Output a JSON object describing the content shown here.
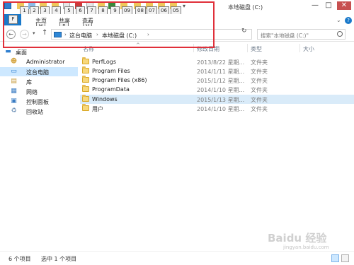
{
  "window": {
    "title": "本地磁盘 (C:)",
    "minimize_glyph": "—",
    "maximize_glyph": "□",
    "close_glyph": "✕"
  },
  "qat": {
    "keytips": [
      "1",
      "2",
      "3",
      "4",
      "5",
      "6",
      "7",
      "8",
      "9",
      "09",
      "08",
      "07",
      "06",
      "05"
    ],
    "more_glyph": "▾"
  },
  "ribbon": {
    "file_keytip": "F",
    "tabs": [
      {
        "label": "主页",
        "keytip": "H"
      },
      {
        "label": "共享",
        "keytip": "S"
      },
      {
        "label": "查看",
        "keytip": "V"
      }
    ],
    "expand_glyph": "⌄",
    "help_glyph": "?"
  },
  "address": {
    "back_glyph": "←",
    "forward_glyph": "→",
    "recent_glyph": "▾",
    "up_glyph": "↑",
    "crumbs": [
      "这台电脑",
      "本地磁盘 (C:)"
    ],
    "separator": "›",
    "dropdown_glyph": "⌄",
    "refresh_glyph": "↻",
    "search_placeholder": "搜索\"本地磁盘 (C:)\""
  },
  "nav": {
    "items": [
      {
        "label": "桌面",
        "icon": "desktop-icon",
        "glyph": "▬",
        "color": "#2f7fd0"
      },
      {
        "label": "Administrator",
        "icon": "user-icon",
        "glyph": "☻",
        "color": "#d6a94a"
      },
      {
        "label": "这台电脑",
        "icon": "computer-icon",
        "glyph": "▭",
        "color": "#2f7fd0"
      },
      {
        "label": "库",
        "icon": "library-icon",
        "glyph": "▤",
        "color": "#c69a3a"
      },
      {
        "label": "网络",
        "icon": "network-icon",
        "glyph": "▦",
        "color": "#3a7cc3"
      },
      {
        "label": "控制面板",
        "icon": "control-panel-icon",
        "glyph": "▣",
        "color": "#3a7cc3"
      },
      {
        "label": "回收站",
        "icon": "recycle-bin-icon",
        "glyph": "♻",
        "color": "#6b8fb5"
      }
    ]
  },
  "list": {
    "columns": [
      "名称",
      "修改日期",
      "类型",
      "大小"
    ],
    "sort_glyph": "^",
    "rows": [
      {
        "name": "PerfLogs",
        "date": "2013/8/22 星期...",
        "type": "文件夹"
      },
      {
        "name": "Program Files",
        "date": "2014/1/11 星期...",
        "type": "文件夹"
      },
      {
        "name": "Program Files (x86)",
        "date": "2015/1/12 星期...",
        "type": "文件夹"
      },
      {
        "name": "ProgramData",
        "date": "2014/1/10 星期...",
        "type": "文件夹"
      },
      {
        "name": "Windows",
        "date": "2015/1/13 星期...",
        "type": "文件夹"
      },
      {
        "name": "用户",
        "date": "2014/1/10 星期...",
        "type": "文件夹"
      }
    ]
  },
  "status": {
    "count": "6 个项目",
    "selected": "选中 1 个项目"
  },
  "watermark": {
    "brand": "Baidu 经验",
    "url": "jingyan.baidu.com"
  },
  "colors": {
    "accent": "#1979ca",
    "selection": "#cde8ff",
    "annotation": "#e0303a"
  }
}
